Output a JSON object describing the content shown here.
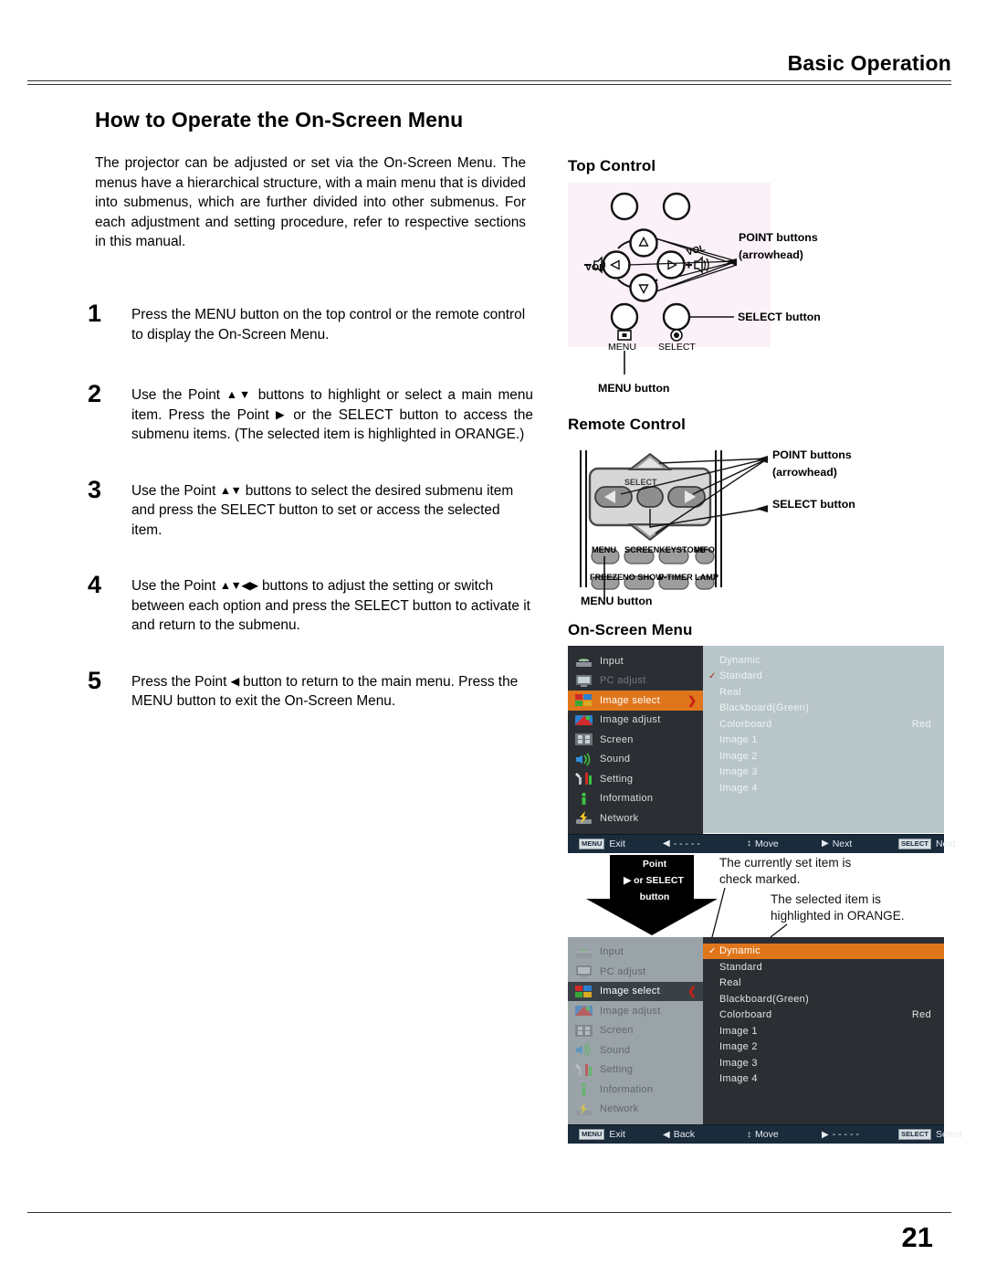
{
  "header": {
    "title": "Basic Operation"
  },
  "footer": {
    "page_number": "21"
  },
  "main": {
    "heading": "How to Operate the On-Screen Menu",
    "intro": "The projector can be adjusted or set via the On-Screen Menu. The menus have a hierarchical structure, with a main menu that is divided into submenus, which are further divided into other submenus. For each adjustment and setting procedure, refer to respective sections in this manual.",
    "steps": [
      {
        "num": "1",
        "text": "Press the MENU button on the top control or the remote control to display the On-Screen Menu."
      },
      {
        "num": "2",
        "text_a": "Use the Point ",
        "glyph_a": "▲▼",
        "text_b": " buttons to highlight or select a main menu item. Press the Point ",
        "glyph_b": "▶",
        "text_c": " or the SELECT button to access the submenu items. (The selected item is highlighted in ORANGE.)"
      },
      {
        "num": "3",
        "text_a": "Use the Point ",
        "glyph_a": "▲▼",
        "text_b": " buttons to select the desired submenu item and press the SELECT button to set or access the selected item."
      },
      {
        "num": "4",
        "text_a": "Use the Point ",
        "glyph_a": "▲▼◀▶",
        "text_b": " buttons to adjust the setting or switch between each option and press the SELECT button to activate it and return to the submenu."
      },
      {
        "num": "5",
        "text_a": "Press the Point ",
        "glyph_a": "◀",
        "text_b": " button to return to the main menu. Press the MENU button to exit the On-Screen Menu."
      }
    ]
  },
  "top_control": {
    "title": "Top Control",
    "labels": {
      "vol_minus": "VOL",
      "vol_plus": "VOL",
      "menu": "MENU",
      "select": "SELECT"
    },
    "callouts": {
      "point_buttons_l1": "POINT buttons",
      "point_buttons_l2": "(arrowhead)",
      "select_button": "SELECT button",
      "menu_button": "MENU button"
    }
  },
  "remote_control": {
    "title": "Remote Control",
    "select_label": "SELECT",
    "buttons_row1": [
      "MENU",
      "SCREEN",
      "KEYSTONE",
      "INFO."
    ],
    "buttons_row2": [
      "FREEZE",
      "NO SHOW",
      "P-TIMER",
      "LAMP"
    ],
    "callouts": {
      "point_buttons_l1": "POINT buttons",
      "point_buttons_l2": "(arrowhead)",
      "select_button": "SELECT button",
      "menu_button": "MENU button"
    }
  },
  "on_screen_menu": {
    "title": "On-Screen Menu",
    "menu_items": [
      {
        "label": "Input",
        "icon": "input-icon"
      },
      {
        "label": "PC adjust",
        "icon": "pc-adjust-icon"
      },
      {
        "label": "Image select",
        "icon": "image-select-icon"
      },
      {
        "label": "Image adjust",
        "icon": "image-adjust-icon"
      },
      {
        "label": "Screen",
        "icon": "screen-icon"
      },
      {
        "label": "Sound",
        "icon": "sound-icon"
      },
      {
        "label": "Setting",
        "icon": "setting-icon"
      },
      {
        "label": "Information",
        "icon": "information-icon"
      },
      {
        "label": "Network",
        "icon": "network-icon"
      }
    ],
    "options": [
      {
        "label": "Dynamic",
        "value": ""
      },
      {
        "label": "Standard",
        "value": ""
      },
      {
        "label": "Real",
        "value": ""
      },
      {
        "label": "Blackboard(Green)",
        "value": ""
      },
      {
        "label": "Colorboard",
        "value": "Red"
      },
      {
        "label": "Image 1",
        "value": ""
      },
      {
        "label": "Image 2",
        "value": ""
      },
      {
        "label": "Image 3",
        "value": ""
      },
      {
        "label": "Image 4",
        "value": ""
      }
    ],
    "shot1": {
      "selected_menu_item": "Image select",
      "checked_option": "Standard",
      "checkmark": "✓",
      "chevron": "❯",
      "bar": [
        {
          "key": "MENU",
          "arrow": "",
          "label": "Exit"
        },
        {
          "key": "",
          "arrow": "◀",
          "label": "- - - - -"
        },
        {
          "key": "",
          "arrow": "↕",
          "label": "Move"
        },
        {
          "key": "",
          "arrow": "▶",
          "label": "Next"
        },
        {
          "key": "SELECT",
          "arrow": "",
          "label": "Next"
        }
      ]
    },
    "shot2": {
      "selected_menu_item": "Image select",
      "highlighted_option": "Dynamic",
      "checked_option": "Dynamic",
      "checkmark": "✓",
      "chevron": "❮",
      "bar": [
        {
          "key": "MENU",
          "arrow": "",
          "label": "Exit"
        },
        {
          "key": "",
          "arrow": "◀",
          "label": "Back"
        },
        {
          "key": "",
          "arrow": "↕",
          "label": "Move"
        },
        {
          "key": "",
          "arrow": "▶",
          "label": "- - - - -"
        },
        {
          "key": "SELECT",
          "arrow": "",
          "label": "Select"
        }
      ]
    },
    "transition_arrow": {
      "line1": "Point",
      "line2_glyph": "▶",
      "line2": "or SELECT",
      "line3": "button"
    },
    "annotations": {
      "checkmark_note_l1": "The currently set item is",
      "checkmark_note_l2": "check marked.",
      "orange_note_l1": "The selected item is",
      "orange_note_l2": "highlighted in ORANGE."
    }
  },
  "colors": {
    "orange_highlight": "#e0761c",
    "menu_dark": "#2b2f33",
    "panel_inactive": "#b9c6c9",
    "status_bar": "#1a2b3c",
    "check_red": "#b0241b",
    "chevron_red": "#c81e14"
  }
}
